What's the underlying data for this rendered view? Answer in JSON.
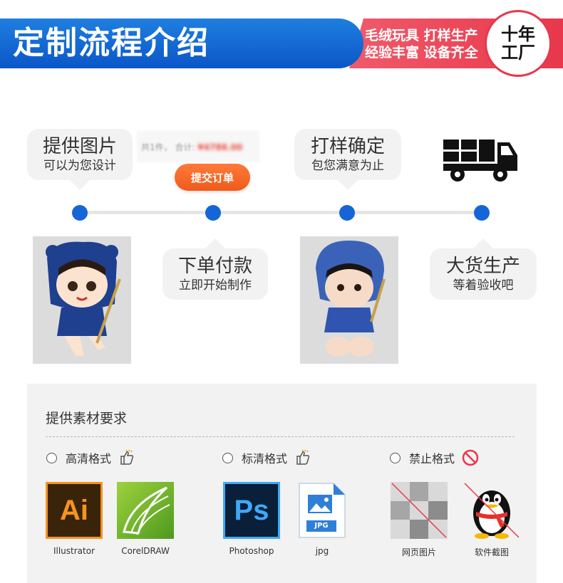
{
  "banner": {
    "title": "定制流程介绍",
    "tagline_line1": "毛绒玩具 打样生产",
    "tagline_line2": "经验丰富 设备齐全",
    "badge_line1": "十年",
    "badge_line2": "工厂",
    "colors": {
      "blue": "#0b56c8",
      "red": "#e8384c"
    }
  },
  "steps": [
    {
      "title": "提供图片",
      "subtitle": "可以为您设计"
    },
    {
      "title": "下单付款",
      "subtitle": "立即开始制作"
    },
    {
      "title": "打样确定",
      "subtitle": "包您满意为止"
    },
    {
      "title": "大货生产",
      "subtitle": "等着验收吧"
    }
  ],
  "order": {
    "count_text": "共1件，",
    "total_label": "合计:",
    "total_value": "¥4788.00",
    "submit_label": "提交订单"
  },
  "requirements": {
    "title": "提供素材要求",
    "groups": [
      {
        "label": "高清格式",
        "icon": "thumbs-up-icon"
      },
      {
        "label": "标清格式",
        "icon": "thumbs-up-icon"
      },
      {
        "label": "禁止格式",
        "icon": "prohibited-icon"
      }
    ],
    "files": [
      {
        "caption": "Illustrator",
        "icon": "illustrator-icon",
        "logo_text": "Ai"
      },
      {
        "caption": "CorelDRAW",
        "icon": "coreldraw-icon"
      },
      {
        "caption": "Photoshop",
        "icon": "photoshop-icon",
        "logo_text": "Ps"
      },
      {
        "caption": "jpg",
        "icon": "jpg-file-icon",
        "logo_text": "JPG"
      },
      {
        "caption": "网页图片",
        "icon": "web-image-icon"
      },
      {
        "caption": "软件截图",
        "icon": "qq-penguin-icon"
      }
    ]
  }
}
